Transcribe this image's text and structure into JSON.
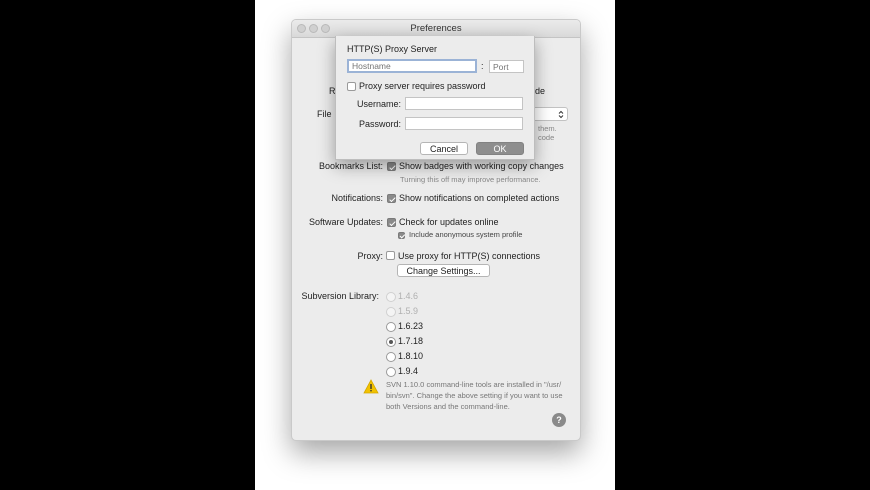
{
  "window": {
    "title": "Preferences"
  },
  "sheet": {
    "title": "HTTP(S) Proxy Server",
    "hostname_placeholder": "Hostname",
    "colon": ":",
    "port_placeholder": "Port",
    "requires_password_label": "Proxy server requires password",
    "requires_password_checked": false,
    "username_label": "Username:",
    "password_label": "Password:",
    "cancel_label": "Cancel",
    "ok_label": "OK"
  },
  "prefs": {
    "partial_r_label": "R",
    "partial_de": "de",
    "file_label_partial": "File",
    "partial_them": "them.",
    "partial_code": "code",
    "bookmarks_label": "Bookmarks List:",
    "bookmarks_option": "Show badges with working copy changes",
    "bookmarks_hint": "Turning this off may improve performance.",
    "notifications_label": "Notifications:",
    "notifications_option": "Show notifications on completed actions",
    "updates_label": "Software Updates:",
    "updates_option": "Check for updates online",
    "anon_option": "Include anonymous system profile",
    "proxy_label": "Proxy:",
    "proxy_option": "Use proxy for HTTP(S) connections",
    "change_settings": "Change Settings...",
    "svn_label": "Subversion Library:",
    "svn_versions": [
      {
        "label": "1.4.6",
        "enabled": false,
        "selected": false
      },
      {
        "label": "1.5.9",
        "enabled": false,
        "selected": false
      },
      {
        "label": "1.6.23",
        "enabled": true,
        "selected": false
      },
      {
        "label": "1.7.18",
        "enabled": true,
        "selected": true
      },
      {
        "label": "1.8.10",
        "enabled": true,
        "selected": false
      },
      {
        "label": "1.9.4",
        "enabled": true,
        "selected": false
      }
    ],
    "svn_warning": [
      "SVN 1.10.0 command-line tools are installed in \"/usr/",
      "bin/svn\". Change the above setting if you want to use",
      "both Versions and the command-line."
    ],
    "help": "?"
  },
  "colors": {
    "warning": "#f2c200",
    "focus_ring": "#9bb3d6",
    "ok_button": "#8e8e8e"
  }
}
